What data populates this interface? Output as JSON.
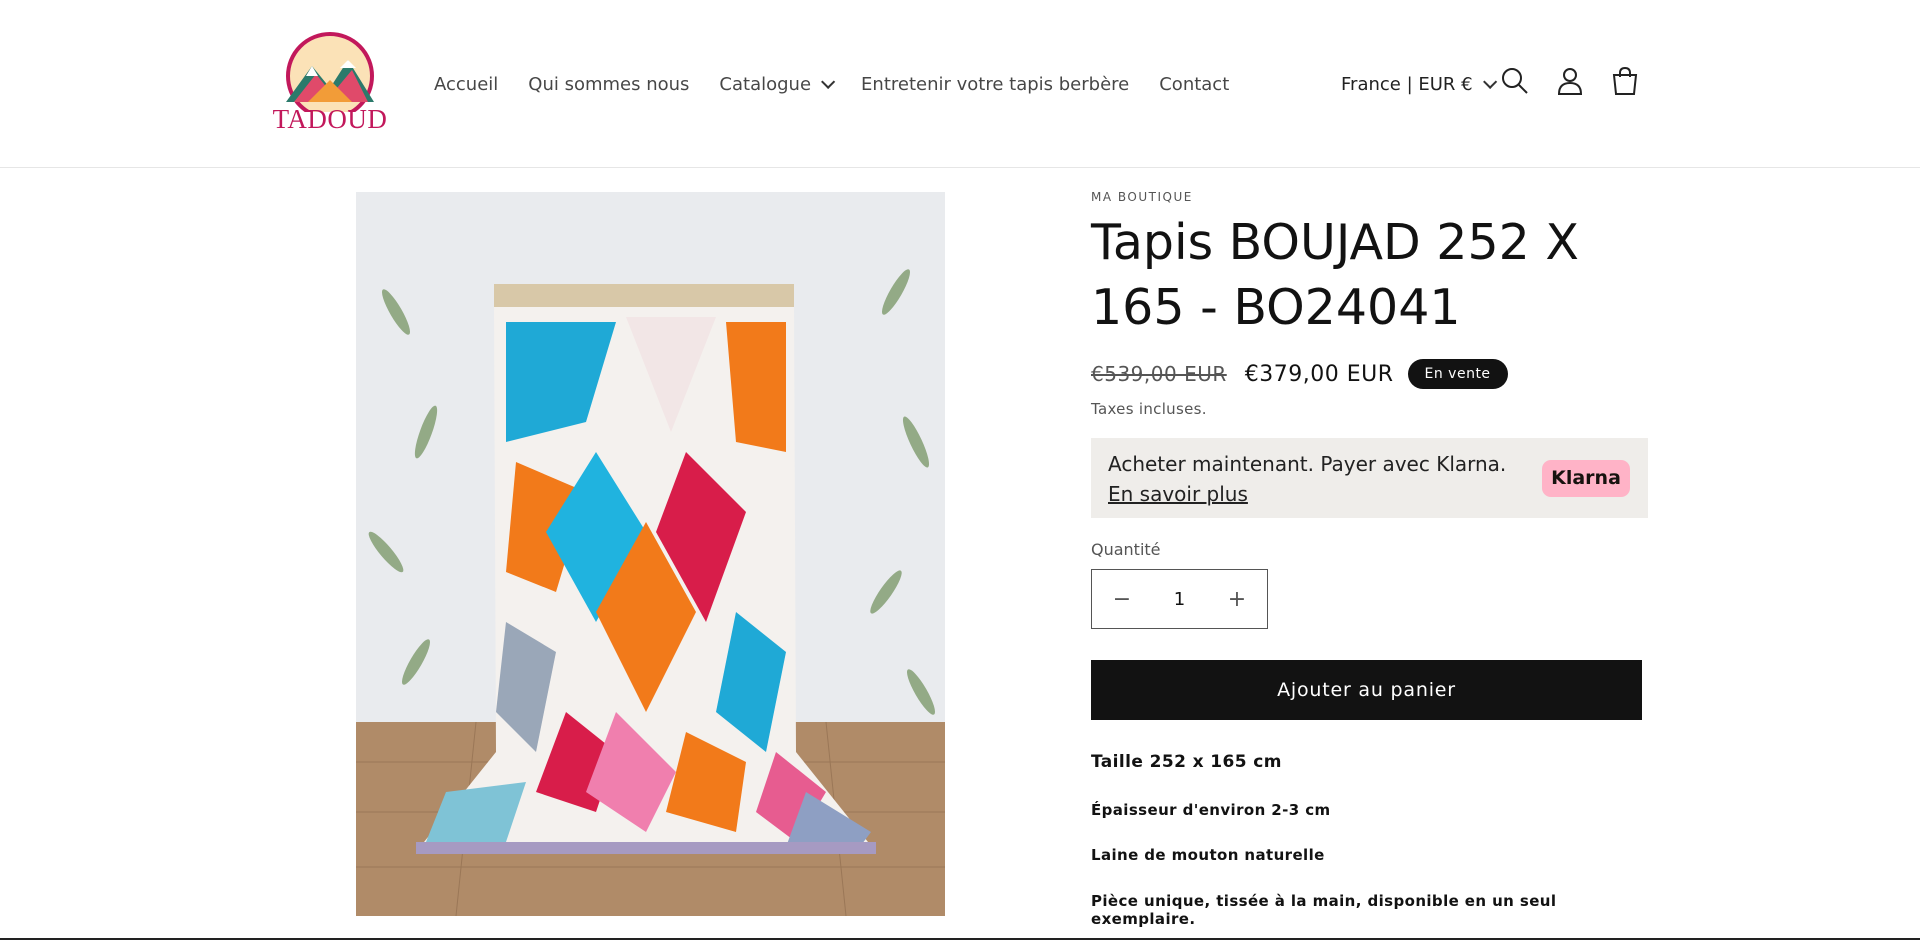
{
  "header": {
    "logo_text": "TADOUD",
    "nav": [
      {
        "label": "Accueil"
      },
      {
        "label": "Qui sommes nous"
      },
      {
        "label": "Catalogue"
      },
      {
        "label": "Entretenir votre tapis berbère"
      },
      {
        "label": "Contact"
      }
    ],
    "country_label": "France | EUR €",
    "icons": [
      "search-icon",
      "account-icon",
      "cart-icon"
    ]
  },
  "product": {
    "vendor": "MA BOUTIQUE",
    "title": "Tapis BOUJAD 252 X 165 - BO24041",
    "price_old": "€539,00 EUR",
    "price_new": "€379,00 EUR",
    "badge": "En vente",
    "tax_note": "Taxes incluses.",
    "klarna": {
      "text": "Acheter maintenant. Payer avec Klarna.",
      "link": "En savoir plus",
      "logo": "Klarna"
    },
    "quantity_label": "Quantité",
    "quantity_value": "1",
    "add_to_cart": "Ajouter au panier",
    "description": [
      "Taille 252 x 165 cm",
      "Épaisseur d'environ 2-3 cm",
      "Laine de mouton naturelle",
      "Pièce unique, tissée à la main, disponible en un seul exemplaire."
    ]
  },
  "colors": {
    "brand": "#c2185b",
    "button": "#121212",
    "klarna_bg": "#efedea",
    "klarna_logo": "#ffb3c7"
  }
}
